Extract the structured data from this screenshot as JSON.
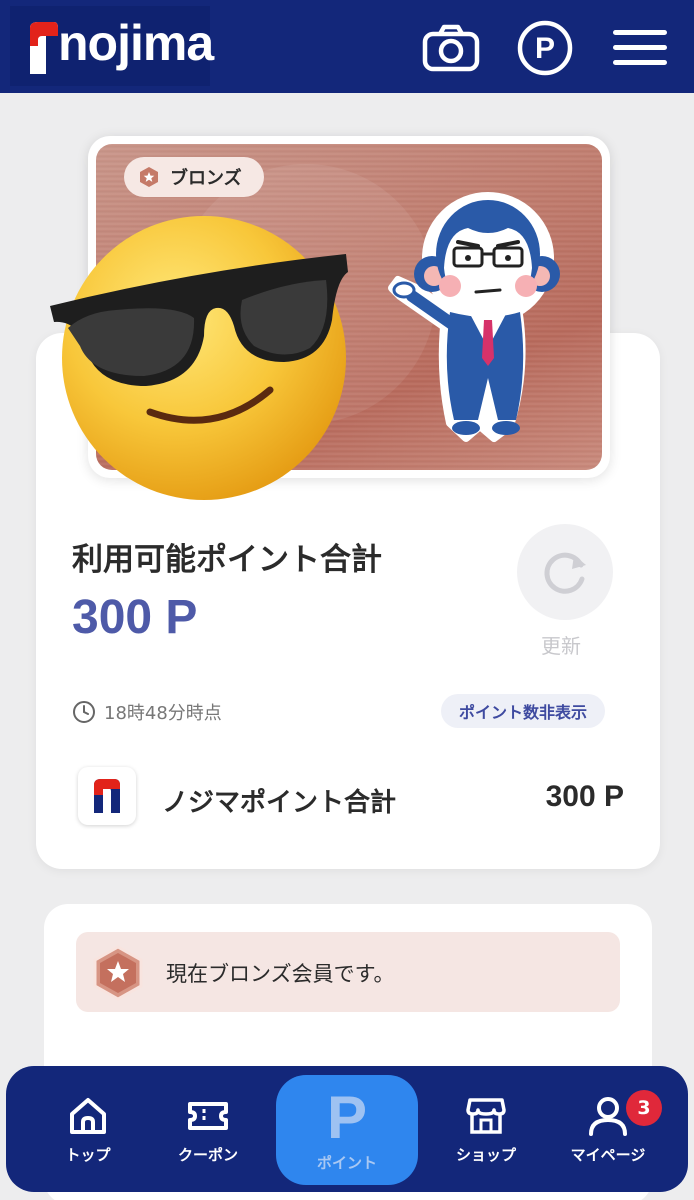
{
  "header": {
    "logo_text": "nojima",
    "camera_icon": "camera-icon",
    "point_icon_letter": "P",
    "menu_icon": "hamburger-icon"
  },
  "member_card": {
    "rank": "ブロンズ",
    "emoji": "sunglasses-emoji",
    "mascot": "monkey-mascot"
  },
  "points": {
    "available_label": "利用可能ポイント合計",
    "available_value": "300 P",
    "refresh_label": "更新",
    "timestamp": "18時48分時点",
    "hide_label": "ポイント数非表示",
    "nojima_label": "ノジマポイント合計",
    "nojima_value": "300 P"
  },
  "status": {
    "message": "現在ブロンズ会員です。"
  },
  "bottom_nav": {
    "items": [
      {
        "label": "トップ",
        "icon": "home-icon"
      },
      {
        "label": "クーポン",
        "icon": "ticket-icon"
      },
      {
        "label": "ポイント",
        "icon": "point-icon",
        "letter": "P"
      },
      {
        "label": "ショップ",
        "icon": "shop-icon"
      },
      {
        "label": "マイページ",
        "icon": "user-icon"
      }
    ],
    "mypage_badge": "3"
  },
  "colors": {
    "brand_navy": "#13277a",
    "accent_blue": "#4e5aa8",
    "bronze": "#c07c6e",
    "badge_red": "#e0283a",
    "center_blue": "#2f86ee"
  }
}
